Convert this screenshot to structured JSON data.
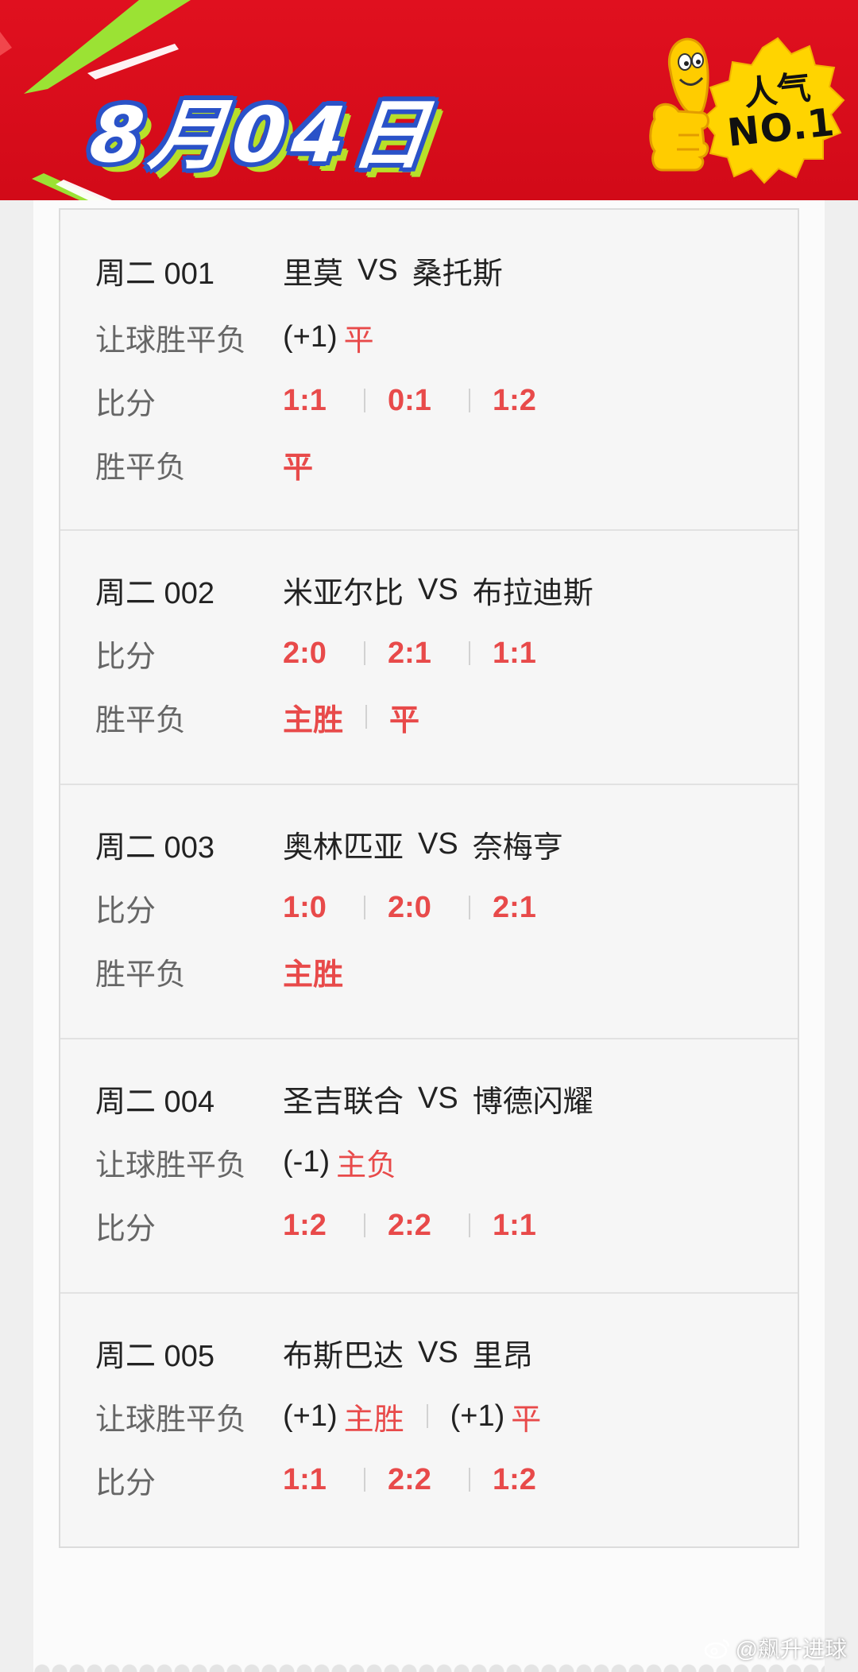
{
  "header": {
    "date": "8月04日",
    "badge_line1": "人气",
    "badge_line2": "NO.1"
  },
  "matches": [
    {
      "code": "周二 001",
      "home": "里莫",
      "vs": "VS",
      "away": "桑托斯",
      "handicap": {
        "label": "让球胜平负",
        "line": "(+1)",
        "pick": "平"
      },
      "scores": {
        "label": "比分",
        "values": [
          "1:1",
          "0:1",
          "1:2"
        ]
      },
      "wdl": {
        "label": "胜平负",
        "values": [
          "平"
        ]
      }
    },
    {
      "code": "周二 002",
      "home": "米亚尔比",
      "vs": "VS",
      "away": "布拉迪斯",
      "scores": {
        "label": "比分",
        "values": [
          "2:0",
          "2:1",
          "1:1"
        ]
      },
      "wdl": {
        "label": "胜平负",
        "values": [
          "主胜",
          "平"
        ]
      }
    },
    {
      "code": "周二 003",
      "home": "奥林匹亚",
      "vs": "VS",
      "away": "奈梅亨",
      "scores": {
        "label": "比分",
        "values": [
          "1:0",
          "2:0",
          "2:1"
        ]
      },
      "wdl": {
        "label": "胜平负",
        "values": [
          "主胜"
        ]
      }
    },
    {
      "code": "周二 004",
      "home": "圣吉联合",
      "vs": "VS",
      "away": "博德闪耀",
      "handicap": {
        "label": "让球胜平负",
        "line": "(-1)",
        "pick": "主负"
      },
      "scores": {
        "label": "比分",
        "values": [
          "1:2",
          "2:2",
          "1:1"
        ]
      }
    },
    {
      "code": "周二 005",
      "home": "布斯巴达",
      "vs": "VS",
      "away": "里昂",
      "handicap2": {
        "label": "让球胜平负",
        "line1": "(+1)",
        "pick1": "主胜",
        "line2": "(+1)",
        "pick2": "平"
      },
      "scores": {
        "label": "比分",
        "values": [
          "1:1",
          "2:2",
          "1:2"
        ]
      }
    }
  ],
  "watermark": "@飙升进球",
  "colors": {
    "banner": "#d20a18",
    "pick": "#e84a4a",
    "title_outline": "#2a52c8",
    "title_shadow": "#b7e02a",
    "badge": "#ffd400"
  }
}
